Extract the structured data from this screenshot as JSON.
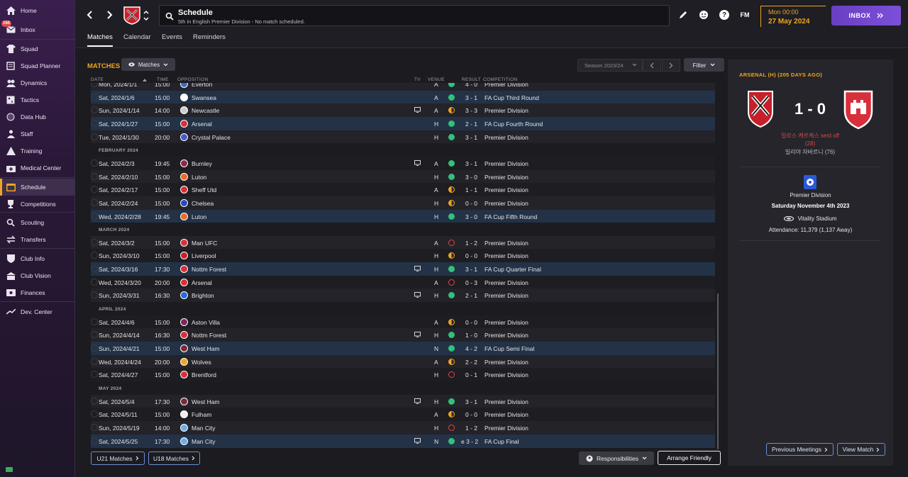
{
  "sidebar": {
    "items": [
      {
        "label": "Home",
        "icon": "home-icon"
      },
      {
        "label": "Inbox",
        "icon": "inbox-icon",
        "badge": "150"
      },
      {
        "label": "Squad",
        "icon": "shirt-icon"
      },
      {
        "label": "Squad Planner",
        "icon": "planner-icon"
      },
      {
        "label": "Dynamics",
        "icon": "dynamics-icon"
      },
      {
        "label": "Tactics",
        "icon": "tactics-icon"
      },
      {
        "label": "Data Hub",
        "icon": "data-hub-icon"
      },
      {
        "label": "Staff",
        "icon": "staff-icon"
      },
      {
        "label": "Training",
        "icon": "training-icon"
      },
      {
        "label": "Medical Center",
        "icon": "medical-icon"
      },
      {
        "label": "Schedule",
        "icon": "schedule-icon"
      },
      {
        "label": "Competitions",
        "icon": "trophy-icon"
      },
      {
        "label": "Scouting",
        "icon": "scouting-icon"
      },
      {
        "label": "Transfers",
        "icon": "transfers-icon"
      },
      {
        "label": "Club Info",
        "icon": "shield-icon"
      },
      {
        "label": "Club Vision",
        "icon": "vision-icon"
      },
      {
        "label": "Finances",
        "icon": "finances-icon"
      },
      {
        "label": "Dev. Center",
        "icon": "dev-center-icon"
      }
    ]
  },
  "header": {
    "title": "Schedule",
    "subtitle": "5th in English Premier Division - No match scheduled.",
    "time": "Mon 00:00",
    "date": "27 May 2024",
    "inbox_label": "INBOX",
    "fm_label": "FM",
    "help_label": "?"
  },
  "tabs": [
    "Matches",
    "Calendar",
    "Events",
    "Reminders"
  ],
  "toolbar": {
    "section_title": "MATCHES",
    "view_label": "Matches",
    "season_label": "Season 2023/24",
    "filter_label": "Filter"
  },
  "columns": {
    "date": "DATE",
    "time": "TIME",
    "opposition": "OPPOSITION",
    "tv": "TV",
    "venue": "VENUE",
    "result": "RESULT",
    "competition": "COMPETITION"
  },
  "rows": [
    {
      "kind": "match",
      "date": "Mon, 2024/1/1",
      "time": "15:00",
      "opp": "Everton",
      "crest": "#3a6cc4",
      "tv": false,
      "venue": "A",
      "res": "W",
      "score": "4 - 0",
      "comp": "Premier Division",
      "cup": false
    },
    {
      "kind": "match",
      "date": "Sat, 2024/1/6",
      "time": "15:00",
      "opp": "Swansea",
      "crest": "#ffffff",
      "tv": false,
      "venue": "A",
      "res": "W",
      "score": "3 - 1",
      "comp": "FA Cup Third Round",
      "cup": true
    },
    {
      "kind": "match",
      "date": "Sun, 2024/1/14",
      "time": "14:00",
      "opp": "Newcastle",
      "crest": "#cccccc",
      "tv": true,
      "venue": "A",
      "res": "D",
      "score": "3 - 3",
      "comp": "Premier Division",
      "cup": false
    },
    {
      "kind": "match",
      "date": "Sat, 2024/1/27",
      "time": "15:00",
      "opp": "Arsenal",
      "crest": "#d8303a",
      "tv": false,
      "venue": "H",
      "res": "W",
      "score": "2 - 1",
      "comp": "FA Cup Fourth Round",
      "cup": true
    },
    {
      "kind": "match",
      "date": "Tue, 2024/1/30",
      "time": "20:00",
      "opp": "Crystal Palace",
      "crest": "#4a5ac8",
      "tv": false,
      "venue": "H",
      "res": "W",
      "score": "3 - 1",
      "comp": "Premier Division",
      "cup": false
    },
    {
      "kind": "month",
      "label": "FEBRUARY 2024"
    },
    {
      "kind": "match",
      "date": "Sat, 2024/2/3",
      "time": "19:45",
      "opp": "Burnley",
      "crest": "#8a2a4a",
      "tv": true,
      "venue": "A",
      "res": "W",
      "score": "3 - 1",
      "comp": "Premier Division",
      "cup": false
    },
    {
      "kind": "match",
      "date": "Sat, 2024/2/10",
      "time": "15:00",
      "opp": "Luton",
      "crest": "#e86a2a",
      "tv": false,
      "venue": "H",
      "res": "W",
      "score": "3 - 0",
      "comp": "Premier Division",
      "cup": false
    },
    {
      "kind": "match",
      "date": "Sat, 2024/2/17",
      "time": "15:00",
      "opp": "Sheff Utd",
      "crest": "#d8303a",
      "tv": false,
      "venue": "A",
      "res": "D",
      "score": "1 - 1",
      "comp": "Premier Division",
      "cup": false
    },
    {
      "kind": "match",
      "date": "Sat, 2024/2/24",
      "time": "15:00",
      "opp": "Chelsea",
      "crest": "#2a4ab8",
      "tv": false,
      "venue": "H",
      "res": "D",
      "score": "0 - 0",
      "comp": "Premier Division",
      "cup": false
    },
    {
      "kind": "match",
      "date": "Wed, 2024/2/28",
      "time": "19:45",
      "opp": "Luton",
      "crest": "#e86a2a",
      "tv": false,
      "venue": "H",
      "res": "W",
      "score": "3 - 0",
      "comp": "FA Cup Fifth Round",
      "cup": true
    },
    {
      "kind": "month",
      "label": "MARCH 2024"
    },
    {
      "kind": "match",
      "date": "Sat, 2024/3/2",
      "time": "15:00",
      "opp": "Man UFC",
      "crest": "#d8303a",
      "tv": false,
      "venue": "A",
      "res": "L",
      "score": "1 - 2",
      "comp": "Premier Division",
      "cup": false
    },
    {
      "kind": "match",
      "date": "Sun, 2024/3/10",
      "time": "15:00",
      "opp": "Liverpool",
      "crest": "#c8202a",
      "tv": false,
      "venue": "H",
      "res": "D",
      "score": "0 - 0",
      "comp": "Premier Division",
      "cup": false
    },
    {
      "kind": "match",
      "date": "Sat, 2024/3/16",
      "time": "17:30",
      "opp": "Nottm Forest",
      "crest": "#d8303a",
      "tv": true,
      "venue": "H",
      "res": "W",
      "score": "3 - 1",
      "comp": "FA Cup Quarter Final",
      "cup": true
    },
    {
      "kind": "match",
      "date": "Wed, 2024/3/20",
      "time": "20:00",
      "opp": "Arsenal",
      "crest": "#d8303a",
      "tv": false,
      "venue": "A",
      "res": "L",
      "score": "0 - 3",
      "comp": "Premier Division",
      "cup": false
    },
    {
      "kind": "match",
      "date": "Sun, 2024/3/31",
      "time": "16:30",
      "opp": "Brighton",
      "crest": "#2a6ad8",
      "tv": true,
      "venue": "H",
      "res": "W",
      "score": "2 - 1",
      "comp": "Premier Division",
      "cup": false
    },
    {
      "kind": "month",
      "label": "APRIL 2024"
    },
    {
      "kind": "match",
      "date": "Sat, 2024/4/6",
      "time": "15:00",
      "opp": "Aston Villa",
      "crest": "#7a2a5a",
      "tv": false,
      "venue": "A",
      "res": "D",
      "score": "0 - 0",
      "comp": "Premier Division",
      "cup": false
    },
    {
      "kind": "match",
      "date": "Sun, 2024/4/14",
      "time": "16:30",
      "opp": "Nottm Forest",
      "crest": "#d8303a",
      "tv": true,
      "venue": "H",
      "res": "W",
      "score": "1 - 0",
      "comp": "Premier Division",
      "cup": false
    },
    {
      "kind": "match",
      "date": "Sun, 2024/4/21",
      "time": "15:00",
      "opp": "West Ham",
      "crest": "#7a2a3a",
      "tv": false,
      "venue": "N",
      "res": "W",
      "score": "4 - 2",
      "comp": "FA Cup Semi Final",
      "cup": true
    },
    {
      "kind": "match",
      "date": "Wed, 2024/4/24",
      "time": "20:00",
      "opp": "Wolves",
      "crest": "#f0a422",
      "tv": false,
      "venue": "A",
      "res": "D",
      "score": "2 - 2",
      "comp": "Premier Division",
      "cup": false
    },
    {
      "kind": "match",
      "date": "Sat, 2024/4/27",
      "time": "15:00",
      "opp": "Brentford",
      "crest": "#d8303a",
      "tv": false,
      "venue": "H",
      "res": "L",
      "score": "0 - 1",
      "comp": "Premier Division",
      "cup": false
    },
    {
      "kind": "month",
      "label": "MAY 2024"
    },
    {
      "kind": "match",
      "date": "Sat, 2024/5/4",
      "time": "17:30",
      "opp": "West Ham",
      "crest": "#7a2a3a",
      "tv": true,
      "venue": "H",
      "res": "W",
      "score": "3 - 1",
      "comp": "Premier Division",
      "cup": false
    },
    {
      "kind": "match",
      "date": "Sat, 2024/5/11",
      "time": "15:00",
      "opp": "Fulham",
      "crest": "#eeeeee",
      "tv": false,
      "venue": "A",
      "res": "D",
      "score": "0 - 0",
      "comp": "Premier Division",
      "cup": false
    },
    {
      "kind": "match",
      "date": "Sun, 2024/5/19",
      "time": "14:00",
      "opp": "Man City",
      "crest": "#6aaee8",
      "tv": false,
      "venue": "H",
      "res": "L",
      "score": "1 - 2",
      "comp": "Premier Division",
      "cup": false
    },
    {
      "kind": "match",
      "date": "Sat, 2024/5/25",
      "time": "17:30",
      "opp": "Man City",
      "crest": "#6aaee8",
      "tv": true,
      "venue": "N",
      "res": "W",
      "score": "e 3 - 2",
      "comp": "FA Cup Final",
      "cup": true
    }
  ],
  "bottom": {
    "u21_label": "U21 Matches",
    "u18_label": "U18 Matches",
    "responsibilities_label": "Responsibilities",
    "friendly_label": "Arrange Friendly"
  },
  "panel": {
    "title": "ARSENAL (H) (205 DAYS AGO)",
    "score": "1 - 0",
    "sent_off": "밀로스 케르케스 sent off",
    "sent_off_minute": "(28)",
    "scorer": "일리야 자바르니 (76)",
    "competition": "Premier Division",
    "match_date": "Saturday November 4th 2023",
    "stadium": "Vitality Stadium",
    "attendance": "Attendance: 11,379 (1,137 Away)",
    "prev_label": "Previous Meetings",
    "view_label": "View Match"
  },
  "colors": {
    "accent": "#f0a422",
    "win": "#31c17a",
    "loss": "#e04646",
    "cup_row": "#233246",
    "inbox": "#7c4fd8"
  }
}
